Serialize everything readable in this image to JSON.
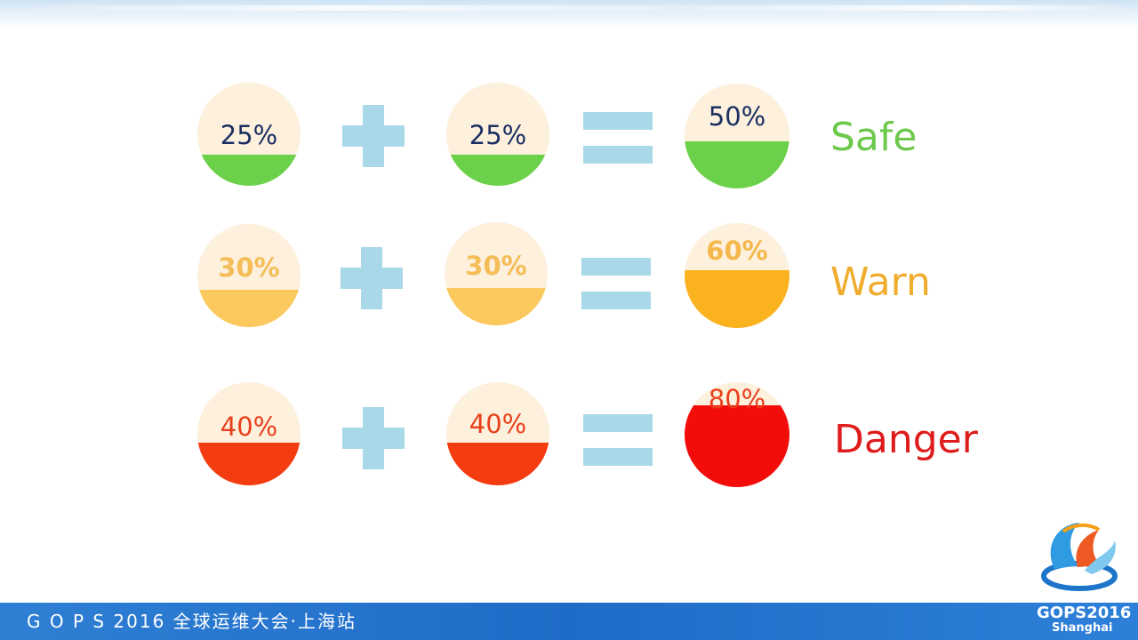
{
  "rows": [
    {
      "left": {
        "label": "25%",
        "fill_fraction": 0.3
      },
      "right": {
        "label": "25%",
        "fill_fraction": 0.3
      },
      "result": {
        "label": "50%",
        "fill_fraction": 0.45
      },
      "status": "Safe",
      "colors": {
        "fill": "#6cd14a",
        "result_fill": "#6cd14a",
        "status": "#6cc94c"
      }
    },
    {
      "left": {
        "label": "30%",
        "fill_fraction": 0.36
      },
      "right": {
        "label": "30%",
        "fill_fraction": 0.36
      },
      "result": {
        "label": "60%",
        "fill_fraction": 0.55
      },
      "status": "Warn",
      "colors": {
        "fill": "#fbc95e",
        "result_fill": "#fbb21f",
        "status": "#f0ad2d"
      }
    },
    {
      "left": {
        "label": "40%",
        "fill_fraction": 0.41
      },
      "right": {
        "label": "40%",
        "fill_fraction": 0.41
      },
      "result": {
        "label": "80%",
        "fill_fraction": 0.78
      },
      "status": "Danger",
      "colors": {
        "fill": "#f43c10",
        "result_fill": "#f20c0a",
        "status": "#df1c1c"
      }
    }
  ],
  "operators": {
    "plus_icon": "plus-icon",
    "equals_icon": "equals-icon"
  },
  "footer": {
    "event_title": "G O P S 2016 全球运维大会·上海站",
    "logo_year": "GOPS2016",
    "logo_city": "Shanghai"
  }
}
